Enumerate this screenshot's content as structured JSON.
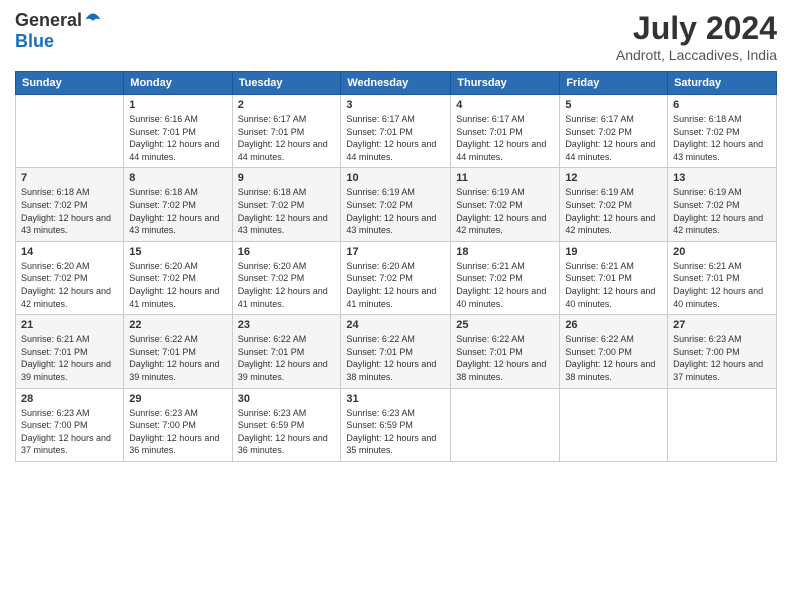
{
  "logo": {
    "general": "General",
    "blue": "Blue"
  },
  "title": "July 2024",
  "subtitle": "Andrott, Laccadives, India",
  "calendar": {
    "headers": [
      "Sunday",
      "Monday",
      "Tuesday",
      "Wednesday",
      "Thursday",
      "Friday",
      "Saturday"
    ],
    "weeks": [
      [
        {
          "day": "",
          "sunrise": "",
          "sunset": "",
          "daylight": ""
        },
        {
          "day": "1",
          "sunrise": "Sunrise: 6:16 AM",
          "sunset": "Sunset: 7:01 PM",
          "daylight": "Daylight: 12 hours and 44 minutes."
        },
        {
          "day": "2",
          "sunrise": "Sunrise: 6:17 AM",
          "sunset": "Sunset: 7:01 PM",
          "daylight": "Daylight: 12 hours and 44 minutes."
        },
        {
          "day": "3",
          "sunrise": "Sunrise: 6:17 AM",
          "sunset": "Sunset: 7:01 PM",
          "daylight": "Daylight: 12 hours and 44 minutes."
        },
        {
          "day": "4",
          "sunrise": "Sunrise: 6:17 AM",
          "sunset": "Sunset: 7:01 PM",
          "daylight": "Daylight: 12 hours and 44 minutes."
        },
        {
          "day": "5",
          "sunrise": "Sunrise: 6:17 AM",
          "sunset": "Sunset: 7:02 PM",
          "daylight": "Daylight: 12 hours and 44 minutes."
        },
        {
          "day": "6",
          "sunrise": "Sunrise: 6:18 AM",
          "sunset": "Sunset: 7:02 PM",
          "daylight": "Daylight: 12 hours and 43 minutes."
        }
      ],
      [
        {
          "day": "7",
          "sunrise": "Sunrise: 6:18 AM",
          "sunset": "Sunset: 7:02 PM",
          "daylight": "Daylight: 12 hours and 43 minutes."
        },
        {
          "day": "8",
          "sunrise": "Sunrise: 6:18 AM",
          "sunset": "Sunset: 7:02 PM",
          "daylight": "Daylight: 12 hours and 43 minutes."
        },
        {
          "day": "9",
          "sunrise": "Sunrise: 6:18 AM",
          "sunset": "Sunset: 7:02 PM",
          "daylight": "Daylight: 12 hours and 43 minutes."
        },
        {
          "day": "10",
          "sunrise": "Sunrise: 6:19 AM",
          "sunset": "Sunset: 7:02 PM",
          "daylight": "Daylight: 12 hours and 43 minutes."
        },
        {
          "day": "11",
          "sunrise": "Sunrise: 6:19 AM",
          "sunset": "Sunset: 7:02 PM",
          "daylight": "Daylight: 12 hours and 42 minutes."
        },
        {
          "day": "12",
          "sunrise": "Sunrise: 6:19 AM",
          "sunset": "Sunset: 7:02 PM",
          "daylight": "Daylight: 12 hours and 42 minutes."
        },
        {
          "day": "13",
          "sunrise": "Sunrise: 6:19 AM",
          "sunset": "Sunset: 7:02 PM",
          "daylight": "Daylight: 12 hours and 42 minutes."
        }
      ],
      [
        {
          "day": "14",
          "sunrise": "Sunrise: 6:20 AM",
          "sunset": "Sunset: 7:02 PM",
          "daylight": "Daylight: 12 hours and 42 minutes."
        },
        {
          "day": "15",
          "sunrise": "Sunrise: 6:20 AM",
          "sunset": "Sunset: 7:02 PM",
          "daylight": "Daylight: 12 hours and 41 minutes."
        },
        {
          "day": "16",
          "sunrise": "Sunrise: 6:20 AM",
          "sunset": "Sunset: 7:02 PM",
          "daylight": "Daylight: 12 hours and 41 minutes."
        },
        {
          "day": "17",
          "sunrise": "Sunrise: 6:20 AM",
          "sunset": "Sunset: 7:02 PM",
          "daylight": "Daylight: 12 hours and 41 minutes."
        },
        {
          "day": "18",
          "sunrise": "Sunrise: 6:21 AM",
          "sunset": "Sunset: 7:02 PM",
          "daylight": "Daylight: 12 hours and 40 minutes."
        },
        {
          "day": "19",
          "sunrise": "Sunrise: 6:21 AM",
          "sunset": "Sunset: 7:01 PM",
          "daylight": "Daylight: 12 hours and 40 minutes."
        },
        {
          "day": "20",
          "sunrise": "Sunrise: 6:21 AM",
          "sunset": "Sunset: 7:01 PM",
          "daylight": "Daylight: 12 hours and 40 minutes."
        }
      ],
      [
        {
          "day": "21",
          "sunrise": "Sunrise: 6:21 AM",
          "sunset": "Sunset: 7:01 PM",
          "daylight": "Daylight: 12 hours and 39 minutes."
        },
        {
          "day": "22",
          "sunrise": "Sunrise: 6:22 AM",
          "sunset": "Sunset: 7:01 PM",
          "daylight": "Daylight: 12 hours and 39 minutes."
        },
        {
          "day": "23",
          "sunrise": "Sunrise: 6:22 AM",
          "sunset": "Sunset: 7:01 PM",
          "daylight": "Daylight: 12 hours and 39 minutes."
        },
        {
          "day": "24",
          "sunrise": "Sunrise: 6:22 AM",
          "sunset": "Sunset: 7:01 PM",
          "daylight": "Daylight: 12 hours and 38 minutes."
        },
        {
          "day": "25",
          "sunrise": "Sunrise: 6:22 AM",
          "sunset": "Sunset: 7:01 PM",
          "daylight": "Daylight: 12 hours and 38 minutes."
        },
        {
          "day": "26",
          "sunrise": "Sunrise: 6:22 AM",
          "sunset": "Sunset: 7:00 PM",
          "daylight": "Daylight: 12 hours and 38 minutes."
        },
        {
          "day": "27",
          "sunrise": "Sunrise: 6:23 AM",
          "sunset": "Sunset: 7:00 PM",
          "daylight": "Daylight: 12 hours and 37 minutes."
        }
      ],
      [
        {
          "day": "28",
          "sunrise": "Sunrise: 6:23 AM",
          "sunset": "Sunset: 7:00 PM",
          "daylight": "Daylight: 12 hours and 37 minutes."
        },
        {
          "day": "29",
          "sunrise": "Sunrise: 6:23 AM",
          "sunset": "Sunset: 7:00 PM",
          "daylight": "Daylight: 12 hours and 36 minutes."
        },
        {
          "day": "30",
          "sunrise": "Sunrise: 6:23 AM",
          "sunset": "Sunset: 6:59 PM",
          "daylight": "Daylight: 12 hours and 36 minutes."
        },
        {
          "day": "31",
          "sunrise": "Sunrise: 6:23 AM",
          "sunset": "Sunset: 6:59 PM",
          "daylight": "Daylight: 12 hours and 35 minutes."
        },
        {
          "day": "",
          "sunrise": "",
          "sunset": "",
          "daylight": ""
        },
        {
          "day": "",
          "sunrise": "",
          "sunset": "",
          "daylight": ""
        },
        {
          "day": "",
          "sunrise": "",
          "sunset": "",
          "daylight": ""
        }
      ]
    ]
  }
}
